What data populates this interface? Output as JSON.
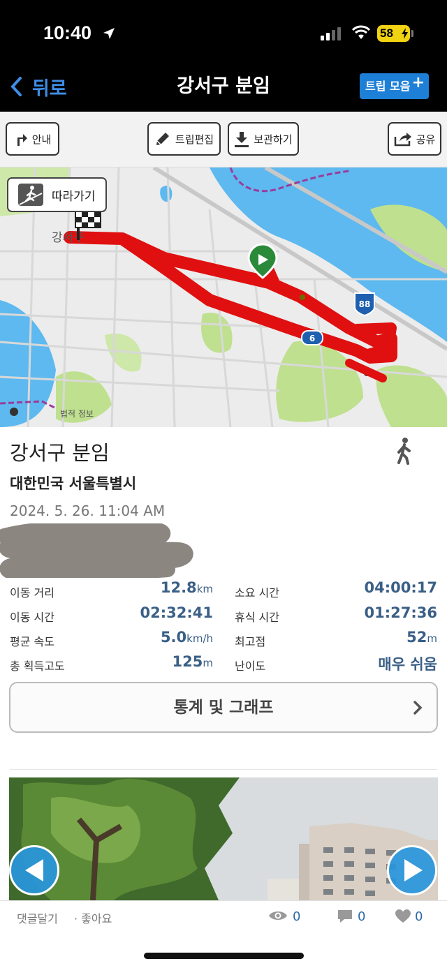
{
  "status_bar": {
    "time": "10:40",
    "battery": "58"
  },
  "nav": {
    "back_label": "뒤로",
    "title": "강서구 분임",
    "trip_collection_label": "트립 모음",
    "trip_collection_plus": "+"
  },
  "toolbar": {
    "guide": "안내",
    "edit_trip": "트립편집",
    "save": "보관하기",
    "share": "공유"
  },
  "map": {
    "follow_label": "따라가기",
    "credit": "법적 정보",
    "place_labels": [
      "강서구",
      "88",
      "6"
    ]
  },
  "trip": {
    "title": "강서구 분임",
    "region": "대한민국 서울특별시",
    "datetime": "2024. 5. 26. 11:04 AM",
    "activity_icon": "walking-icon"
  },
  "stats": {
    "distance_label": "이동 거리",
    "distance_value": "12.8",
    "distance_unit": "km",
    "total_time_label": "소요 시간",
    "total_time_value": "04:00:17",
    "moving_time_label": "이동 시간",
    "moving_time_value": "02:32:41",
    "rest_time_label": "휴식 시간",
    "rest_time_value": "01:27:36",
    "avg_speed_label": "평균 속도",
    "avg_speed_value": "5.0",
    "avg_speed_unit": "km/h",
    "max_elev_label": "최고점",
    "max_elev_value": "52",
    "max_elev_unit": "m",
    "total_gain_label": "총 획득고도",
    "total_gain_value": "125",
    "total_gain_unit": "m",
    "difficulty_label": "난이도",
    "difficulty_value": "매우 쉬움"
  },
  "stats_button_label": "통계 및 그래프",
  "bottom_bar": {
    "comment_label": "댓글달기",
    "like_label": "· 좋아요",
    "views": "0",
    "comments": "0",
    "likes": "0"
  },
  "colors": {
    "accent": "#1e7fd6",
    "route": "#e01010",
    "value_text": "#3a5f86",
    "water": "#5db9ef"
  }
}
